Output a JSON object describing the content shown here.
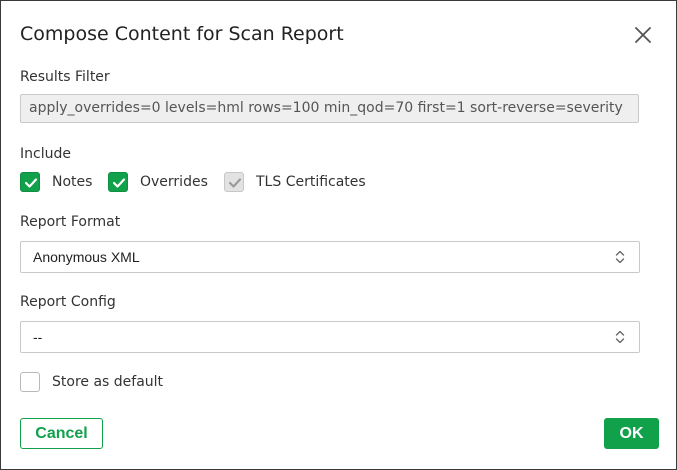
{
  "dialog": {
    "title": "Compose Content for Scan Report"
  },
  "results_filter": {
    "label": "Results Filter",
    "value": "apply_overrides=0 levels=hml rows=100 min_qod=70 first=1 sort-reverse=severity"
  },
  "include": {
    "label": "Include",
    "options": [
      {
        "label": "Notes",
        "checked": true,
        "disabled": false
      },
      {
        "label": "Overrides",
        "checked": true,
        "disabled": false
      },
      {
        "label": "TLS Certificates",
        "checked": true,
        "disabled": true
      }
    ]
  },
  "report_format": {
    "label": "Report Format",
    "selected": "Anonymous XML"
  },
  "report_config": {
    "label": "Report Config",
    "selected": "--"
  },
  "store_default": {
    "label": "Store as default",
    "checked": false
  },
  "buttons": {
    "cancel": "Cancel",
    "ok": "OK"
  },
  "colors": {
    "accent": "#11a14b"
  }
}
